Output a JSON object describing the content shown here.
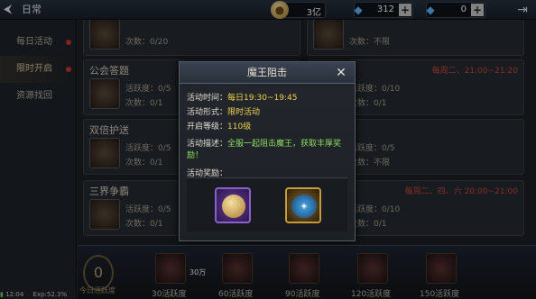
{
  "topbar": {
    "title": "日常",
    "gold_value": "3亿",
    "gem_value": "312",
    "bound_gem_value": "0"
  },
  "sidebar": {
    "items": [
      {
        "label": "每日活动"
      },
      {
        "label": "限时开启"
      },
      {
        "label": "资源找回"
      }
    ]
  },
  "cards": {
    "r0_left_line": "次数：0/20",
    "r0_right_line": "次数：不限",
    "r1_left_title": "公会答题",
    "r1_left_time": "每",
    "r1_left_l1": "活跃度：0/5",
    "r1_left_l2": "次数：0/1",
    "r1_right_time": "每周二、21:00~21:20",
    "r1_right_l1": "活跃度：0/10",
    "r1_right_l2": "次数：0/1",
    "r2_left_title": "双倍护送",
    "r2_left_l1": "活跃度：0/5",
    "r2_left_l2": "次数：0/1",
    "r2_right_l1": "活跃度：0/5",
    "r2_right_l2": "次数：不限",
    "r3_left_title": "三界争霸",
    "r3_left_l1": "活跃度：0/5",
    "r3_left_l2": "次数：0/1",
    "r3_right_time": "每周二、四、六 20:00~21:00",
    "r3_right_l1": "活跃度：0/10",
    "r3_right_l2": "次数：0/1"
  },
  "bottombar": {
    "current": "0",
    "current_label": "今日活跃度",
    "coin_overlay": "30万",
    "rewards": [
      {
        "label": "30活跃度"
      },
      {
        "label": "60活跃度"
      },
      {
        "label": "90活跃度"
      },
      {
        "label": "120活跃度"
      },
      {
        "label": "150活跃度"
      }
    ]
  },
  "statusbar": {
    "time": "12:04",
    "exp": "Exp:52.3%"
  },
  "modal": {
    "title": "魔王阻击",
    "time_label": "活动时间：",
    "time_value": "每日19:30~19:45",
    "form_label": "活动形式：",
    "form_value": "限时活动",
    "level_label": "开启等级：",
    "level_value": "110级",
    "desc_label": "活动描述：",
    "desc_value": "全服一起阻击魔王，获取丰厚奖励！",
    "reward_label": "活动奖励："
  }
}
